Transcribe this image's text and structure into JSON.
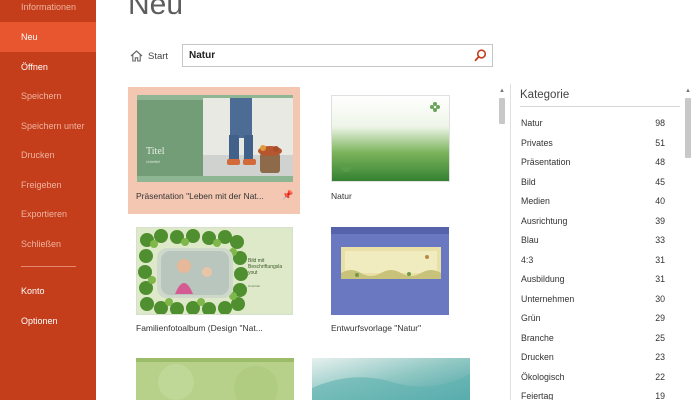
{
  "sidebar": {
    "items": [
      {
        "label": "Informationen",
        "state": "disabled"
      },
      {
        "label": "Neu",
        "state": "selected"
      },
      {
        "label": "Öffnen",
        "state": "enabled"
      },
      {
        "label": "Speichern",
        "state": "disabled"
      },
      {
        "label": "Speichern unter",
        "state": "disabled"
      },
      {
        "label": "Drucken",
        "state": "disabled"
      },
      {
        "label": "Freigeben",
        "state": "disabled"
      },
      {
        "label": "Exportieren",
        "state": "disabled"
      },
      {
        "label": "Schließen",
        "state": "disabled"
      }
    ],
    "lower_items": [
      {
        "label": "Konto",
        "state": "enabled"
      },
      {
        "label": "Optionen",
        "state": "enabled"
      }
    ],
    "colors": {
      "background": "#c43e1c",
      "selected": "#e8562f"
    }
  },
  "main": {
    "title": "Neu",
    "home_label": "Start",
    "search": {
      "value": "Natur",
      "icon": "search-icon"
    }
  },
  "templates": [
    {
      "label": "Präsentation \"Leben mit der Nat...",
      "thumb_title": "Titel",
      "thumb_subtitle": "Untertitel",
      "pinned": true,
      "selected": true
    },
    {
      "label": "Natur",
      "pinned": false,
      "selected": false
    },
    {
      "label": "Familienfotoalbum (Design \"Nat...",
      "thumb_text": "Bild mit Beschriftungsla yout",
      "thumb_subtext": "Untertitel",
      "pinned": false,
      "selected": false
    },
    {
      "label": "Entwurfsvorlage \"Natur\"",
      "pinned": false,
      "selected": false
    },
    {
      "label": "",
      "pinned": false,
      "selected": false
    },
    {
      "label": "",
      "pinned": false,
      "selected": false
    }
  ],
  "categories": {
    "title": "Kategorie",
    "items": [
      {
        "name": "Natur",
        "count": "98"
      },
      {
        "name": "Privates",
        "count": "51"
      },
      {
        "name": "Präsentation",
        "count": "48"
      },
      {
        "name": "Bild",
        "count": "45"
      },
      {
        "name": "Medien",
        "count": "40"
      },
      {
        "name": "Ausrichtung",
        "count": "39"
      },
      {
        "name": "Blau",
        "count": "33"
      },
      {
        "name": "4:3",
        "count": "31"
      },
      {
        "name": "Ausbildung",
        "count": "31"
      },
      {
        "name": "Unternehmen",
        "count": "30"
      },
      {
        "name": "Grün",
        "count": "29"
      },
      {
        "name": "Branche",
        "count": "25"
      },
      {
        "name": "Drucken",
        "count": "23"
      },
      {
        "name": "Ökologisch",
        "count": "22"
      },
      {
        "name": "Feiertag",
        "count": "19"
      }
    ]
  }
}
